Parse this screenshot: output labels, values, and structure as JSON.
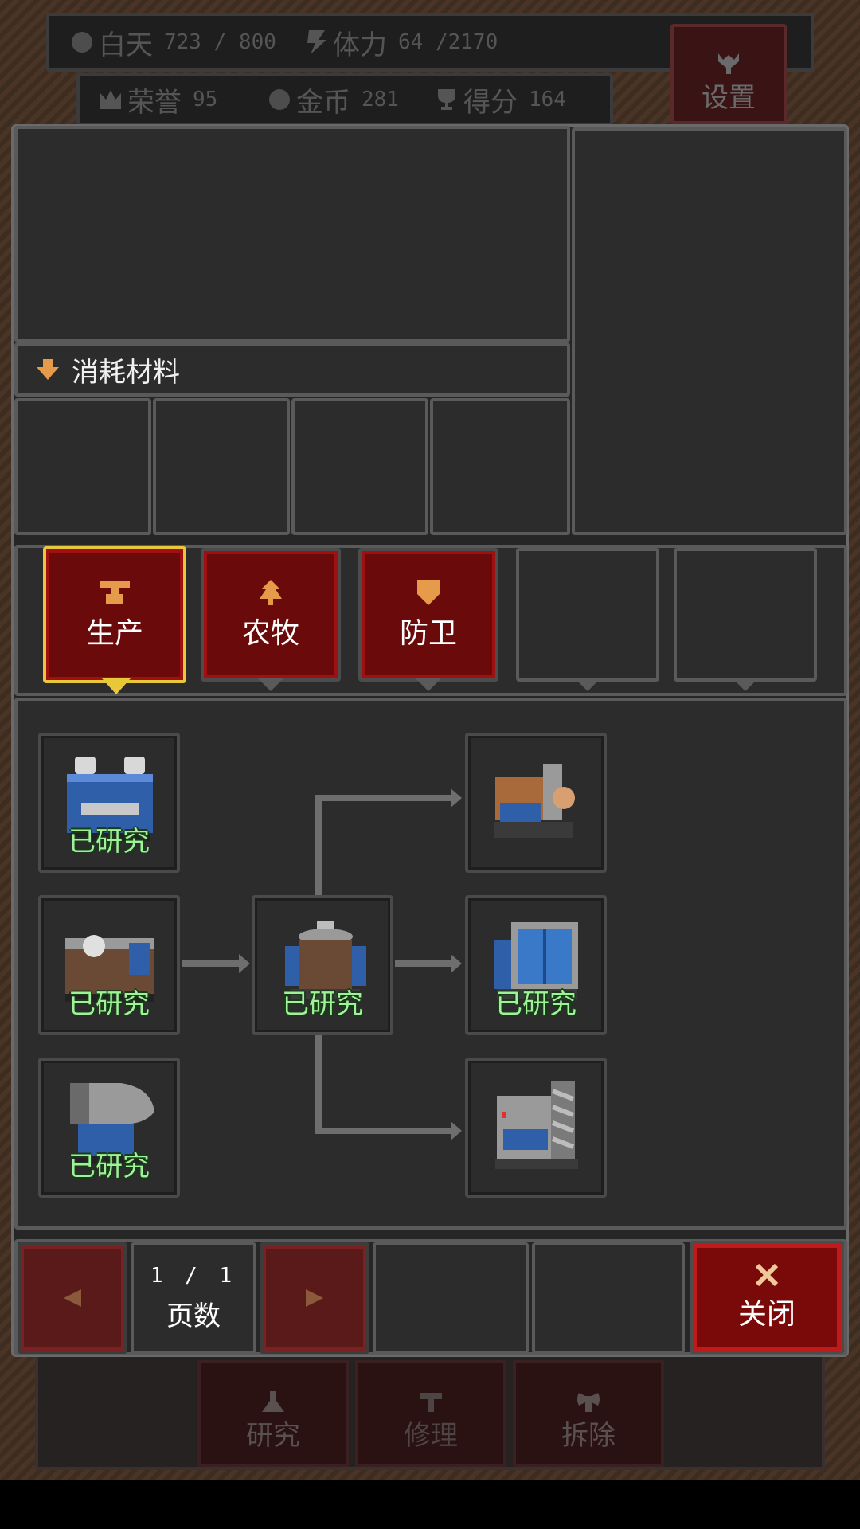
{
  "hud": {
    "day_label": "白天",
    "day_value": "723 / 800",
    "stamina_label": "体力",
    "stamina_value": "64 /2170",
    "honor_label": "荣誉",
    "honor_value": "95",
    "gold_label": "金币",
    "gold_value": "281",
    "score_label": "得分",
    "score_value": "164",
    "settings_label": "设置"
  },
  "materials": {
    "label": "消耗材料",
    "slots": [
      null,
      null,
      null,
      null
    ]
  },
  "tabs": [
    {
      "label": "生产",
      "icon": "anvil-icon",
      "selected": true
    },
    {
      "label": "农牧",
      "icon": "tree-icon",
      "selected": false
    },
    {
      "label": "防卫",
      "icon": "shield-icon",
      "selected": false
    },
    {
      "label": "",
      "icon": "",
      "selected": false
    },
    {
      "label": "",
      "icon": "",
      "selected": false
    }
  ],
  "tech_tree": {
    "researched_label": "已研究",
    "nodes": [
      {
        "name": "workbench",
        "researched": true
      },
      {
        "name": "chest-storage",
        "researched": false
      },
      {
        "name": "lathe",
        "researched": true
      },
      {
        "name": "furnace",
        "researched": true
      },
      {
        "name": "glass-cabinet",
        "researched": true
      },
      {
        "name": "anvil-station",
        "researched": true
      },
      {
        "name": "drill-machine",
        "researched": false
      }
    ]
  },
  "pagination": {
    "current": "1",
    "separator": "/",
    "total": "1",
    "label": "页数"
  },
  "close_label": "关闭",
  "under_buttons": {
    "research": "研究",
    "repair": "修理",
    "demolish": "拆除"
  },
  "colors": {
    "tab_red": "#6a0a0a",
    "selected_border": "#e8c838",
    "researched_green": "#9ff29a"
  }
}
